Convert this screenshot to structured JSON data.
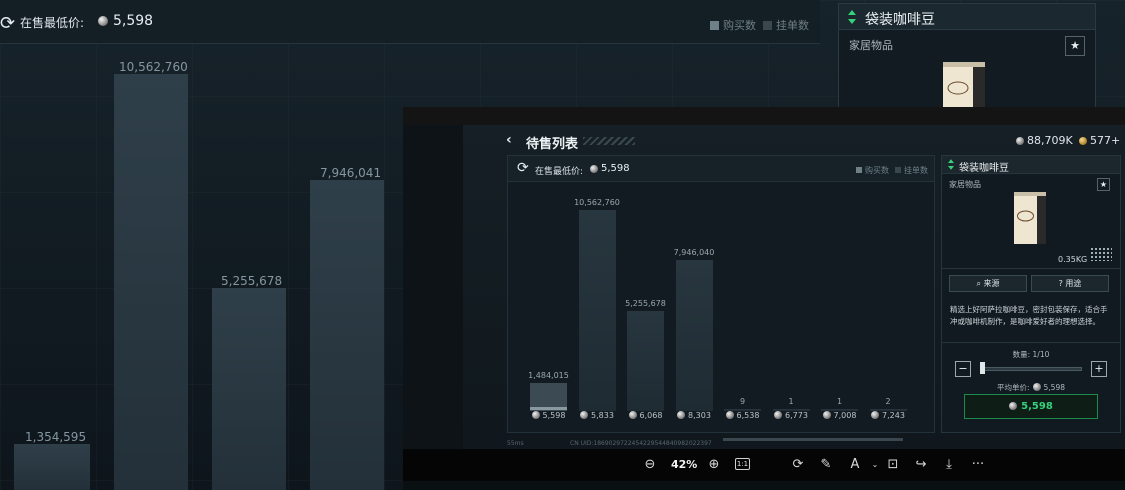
{
  "background": {
    "lowest_price_label": "在售最低价:",
    "lowest_price": "5,598",
    "legend": [
      "购买数",
      "挂单数"
    ],
    "bar_labels": [
      "1,354,595",
      "10,562,760",
      "5,255,678",
      "7,946,041"
    ],
    "axis_ticks": [
      "9",
      "1",
      "1",
      "2"
    ],
    "card": {
      "title": "袋装咖啡豆",
      "category": "家居物品",
      "star": "★"
    }
  },
  "window": {
    "back_icon": "‹",
    "title": "待售列表",
    "currency": [
      {
        "icon": "silver-coin",
        "value": "88,709K"
      },
      {
        "icon": "gold-coin",
        "value": "577+"
      }
    ]
  },
  "market": {
    "lowest_price_label": "在售最低价:",
    "lowest_price": "5,598",
    "legend": [
      "购买数",
      "挂单数"
    ],
    "status": [
      "55ms",
      "CN UID:1869029722454229544840982022397"
    ]
  },
  "chart_data": {
    "type": "bar",
    "categories": [
      "5,598",
      "5,833",
      "6,068",
      "8,303",
      "6,538",
      "6,773",
      "7,008",
      "7,243"
    ],
    "series": [
      {
        "values": [
          1484015,
          10562760,
          5255678,
          7946040,
          9,
          1,
          1,
          2
        ]
      }
    ],
    "value_labels": [
      "1,484,015",
      "10,562,760",
      "5,255,678",
      "7,946,040",
      "9",
      "1",
      "1",
      "2"
    ],
    "legend": [
      "购买数",
      "挂单数"
    ],
    "ylim": [
      0,
      12000000
    ]
  },
  "item": {
    "title": "袋装咖啡豆",
    "category": "家居物品",
    "star": "★",
    "weight": "0.35KG",
    "source_button": "来源",
    "use_button": "用途",
    "description": "精选上好阿萨拉咖啡豆，密封包装保存，适合手冲或咖啡机制作，是咖啡爱好者的理想选择。",
    "quantity_label": "数量: 1/10",
    "quantity": 1,
    "quantity_max": 10,
    "unit_price_label": "平均单价:",
    "unit_price": "5,598",
    "buy_price": "5,598"
  },
  "toolbar": {
    "zoom": "42%",
    "fit_label": "1:1",
    "more": "···"
  },
  "colors": {
    "accent_green": "#35d27a",
    "bar": "#28363f",
    "background": "#0b1217"
  }
}
